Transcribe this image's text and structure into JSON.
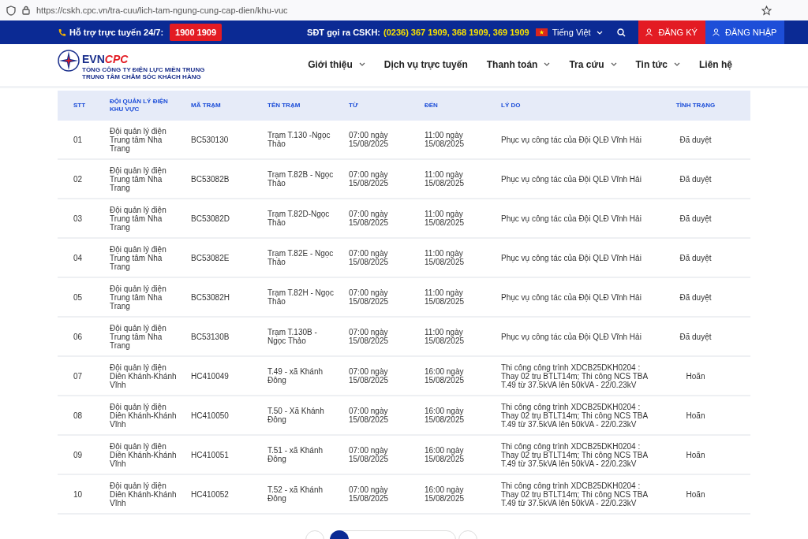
{
  "browser": {
    "url": "https://cskh.cpc.vn/tra-cuu/lich-tam-ngung-cung-cap-dien/khu-vuc"
  },
  "topbar": {
    "support_label": "Hỗ trợ trực tuyến 24/7:",
    "hotline": "1900 1909",
    "cskh_label": "SĐT gọi ra CSKH:",
    "cskh_numbers": "(0236) 367 1909, 368 1909, 369 1909",
    "language": "Tiếng Việt",
    "register": "ĐĂNG KÝ",
    "login": "ĐĂNG NHẬP"
  },
  "logo": {
    "brand_a": "EVN",
    "brand_b": "CPC",
    "line_1": "TỔNG CÔNG TY ĐIỆN LỰC MIỀN TRUNG",
    "line_2": "TRUNG TÂM CHĂM SÓC KHÁCH HÀNG"
  },
  "nav": [
    {
      "label": "Giới thiệu",
      "has_menu": true
    },
    {
      "label": "Dịch vụ trực tuyến",
      "has_menu": false
    },
    {
      "label": "Thanh toán",
      "has_menu": true
    },
    {
      "label": "Tra cứu",
      "has_menu": true
    },
    {
      "label": "Tin tức",
      "has_menu": true
    },
    {
      "label": "Liên hệ",
      "has_menu": false
    }
  ],
  "table": {
    "columns": [
      "STT",
      "ĐỘI QUẢN LÝ ĐIỆN KHU VỰC",
      "MÃ TRẠM",
      "TÊN TRẠM",
      "TỪ",
      "ĐẾN",
      "LÝ DO",
      "TÌNH TRẠNG"
    ],
    "rows": [
      [
        "01",
        "Đội quản lý điện Trung tâm Nha Trang",
        "BC530130",
        "Trạm T.130 -Ngọc Thảo",
        "07:00 ngày 15/08/2025",
        "11:00 ngày 15/08/2025",
        "Phục vụ công tác của Đội QLĐ Vĩnh Hải",
        "Đã duyệt"
      ],
      [
        "02",
        "Đội quản lý điện Trung tâm Nha Trang",
        "BC53082B",
        "Trạm T.82B - Ngọc Thảo",
        "07:00 ngày 15/08/2025",
        "11:00 ngày 15/08/2025",
        "Phục vụ công tác của Đội QLĐ Vĩnh Hải",
        "Đã duyệt"
      ],
      [
        "03",
        "Đội quản lý điện Trung tâm Nha Trang",
        "BC53082D",
        "Trạm T.82D-Ngọc Thảo",
        "07:00 ngày 15/08/2025",
        "11:00 ngày 15/08/2025",
        "Phục vụ công tác của Đội QLĐ Vĩnh Hải",
        "Đã duyệt"
      ],
      [
        "04",
        "Đội quản lý điện Trung tâm Nha Trang",
        "BC53082E",
        "Trạm T.82E - Ngọc Thảo",
        "07:00 ngày 15/08/2025",
        "11:00 ngày 15/08/2025",
        "Phục vụ công tác của Đội QLĐ Vĩnh Hải",
        "Đã duyệt"
      ],
      [
        "05",
        "Đội quản lý điện Trung tâm Nha Trang",
        "BC53082H",
        "Trạm T.82H - Ngọc Thảo",
        "07:00 ngày 15/08/2025",
        "11:00 ngày 15/08/2025",
        "Phục vụ công tác của Đội QLĐ Vĩnh Hải",
        "Đã duyệt"
      ],
      [
        "06",
        "Đội quản lý điện Trung tâm Nha Trang",
        "BC53130B",
        "Trạm T.130B - Ngọc Thảo",
        "07:00 ngày 15/08/2025",
        "11:00 ngày 15/08/2025",
        "Phục vụ công tác của Đội QLĐ Vĩnh Hải",
        "Đã duyệt"
      ],
      [
        "07",
        "Đội quản lý điện Diên Khánh-Khánh Vĩnh",
        "HC410049",
        "T.49 - xã Khánh Đông",
        "07:00 ngày 15/08/2025",
        "16:00 ngày 15/08/2025",
        "Thi công công trình XDCB25DKH0204 : Thay 02 trụ BTLT14m; Thi công NCS TBA T.49 từ 37.5kVA lên 50kVA - 22/0.23kV",
        "Hoãn"
      ],
      [
        "08",
        "Đội quản lý điện Diên Khánh-Khánh Vĩnh",
        "HC410050",
        "T.50 - Xã Khánh Đông",
        "07:00 ngày 15/08/2025",
        "16:00 ngày 15/08/2025",
        "Thi công công trình XDCB25DKH0204 : Thay 02 trụ BTLT14m; Thi công NCS TBA T.49 từ 37.5kVA lên 50kVA - 22/0.23kV",
        "Hoãn"
      ],
      [
        "09",
        "Đội quản lý điện Diên Khánh-Khánh Vĩnh",
        "HC410051",
        "T.51 - xã Khánh Đông",
        "07:00 ngày 15/08/2025",
        "16:00 ngày 15/08/2025",
        "Thi công công trình XDCB25DKH0204 : Thay 02 trụ BTLT14m; Thi công NCS TBA T.49 từ 37.5kVA lên 50kVA - 22/0.23kV",
        "Hoãn"
      ],
      [
        "10",
        "Đội quản lý điện Diên Khánh-Khánh Vĩnh",
        "HC410052",
        "T.52 - xã Khánh Đông",
        "07:00 ngày 15/08/2025",
        "16:00 ngày 15/08/2025",
        "Thi công công trình XDCB25DKH0204 : Thay 02 trụ BTLT14m; Thi công NCS TBA T.49 từ 37.5kVA lên 50kVA - 22/0.23kV",
        "Hoãn"
      ]
    ]
  }
}
